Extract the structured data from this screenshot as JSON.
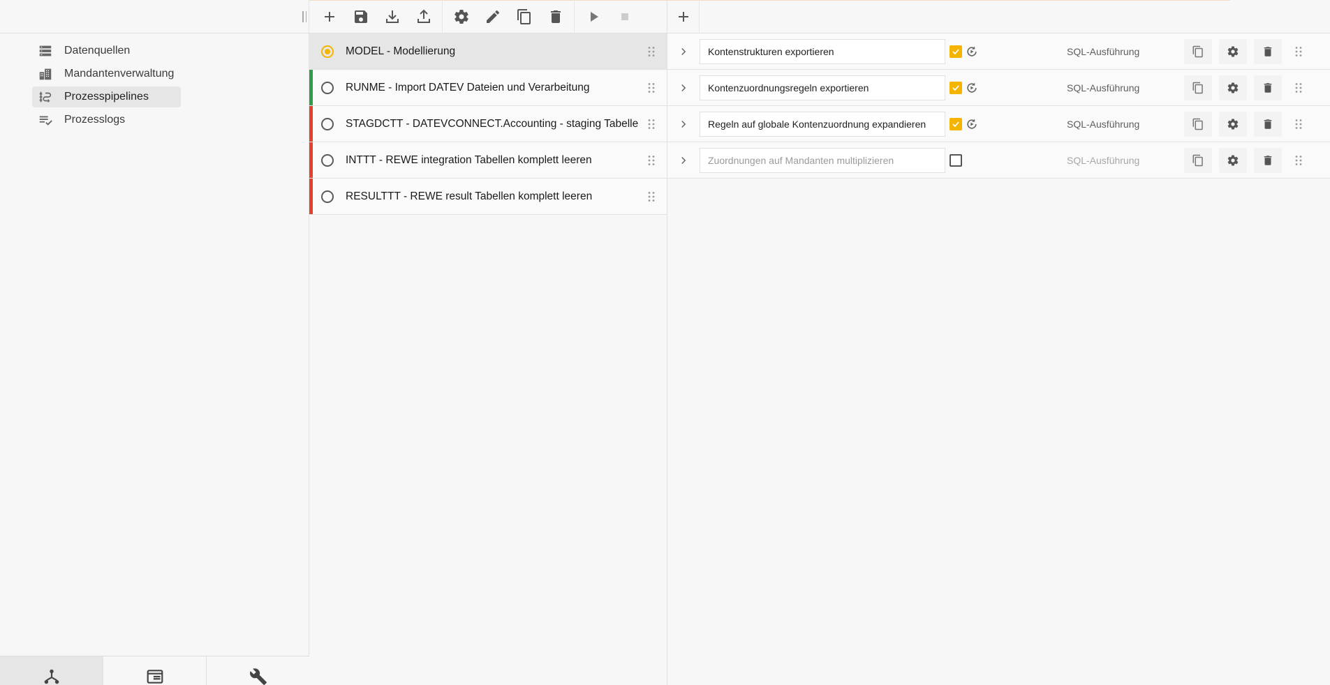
{
  "colors": {
    "accent": "#f5b400",
    "status_green": "#2e9e4b",
    "status_red": "#e4402a",
    "selected_bg": "#e6e6e6"
  },
  "sidebar": {
    "items": [
      {
        "label": "Datenquellen",
        "icon": "database-list-icon"
      },
      {
        "label": "Mandantenverwaltung",
        "icon": "buildings-icon"
      },
      {
        "label": "Prozesspipelines",
        "icon": "pipeline-icon",
        "active": true
      },
      {
        "label": "Prozesslogs",
        "icon": "log-list-check-icon"
      }
    ],
    "bottom_tabs": [
      {
        "name": "tree",
        "icon": "hierarchy-icon",
        "active": true
      },
      {
        "name": "window",
        "icon": "browser-window-icon"
      },
      {
        "name": "tools",
        "icon": "wrench-icon"
      }
    ]
  },
  "toolbar": {
    "buttons": [
      "add-icon",
      "save-icon",
      "import-icon",
      "export-icon",
      "settings-icon",
      "edit-icon",
      "copy-icon",
      "delete-icon",
      "play-icon",
      "stop-icon"
    ]
  },
  "pipelines": [
    {
      "label": "MODEL - Modellierung",
      "status": "none",
      "selected": true
    },
    {
      "label": "RUNME - Import DATEV Dateien und Verarbeitung",
      "status": "green"
    },
    {
      "label": "STAGDCTT - DATEVCONNECT.Accounting - staging Tabelle",
      "status": "red"
    },
    {
      "label": "INTTT - REWE integration Tabellen komplett leeren",
      "status": "red"
    },
    {
      "label": "RESULTTT - REWE result Tabellen komplett leeren",
      "status": "red"
    }
  ],
  "steps": [
    {
      "name": "Kontenstrukturen exportieren",
      "enabled": true,
      "type": "SQL-Ausführung"
    },
    {
      "name": "Kontenzuordnungsregeln exportieren",
      "enabled": true,
      "type": "SQL-Ausführung"
    },
    {
      "name": "Regeln auf globale Kontenzuordnung expandieren",
      "enabled": true,
      "type": "SQL-Ausführung"
    },
    {
      "name": "Zuordnungen auf Mandanten multiplizieren",
      "enabled": false,
      "type": "SQL-Ausführung"
    }
  ]
}
